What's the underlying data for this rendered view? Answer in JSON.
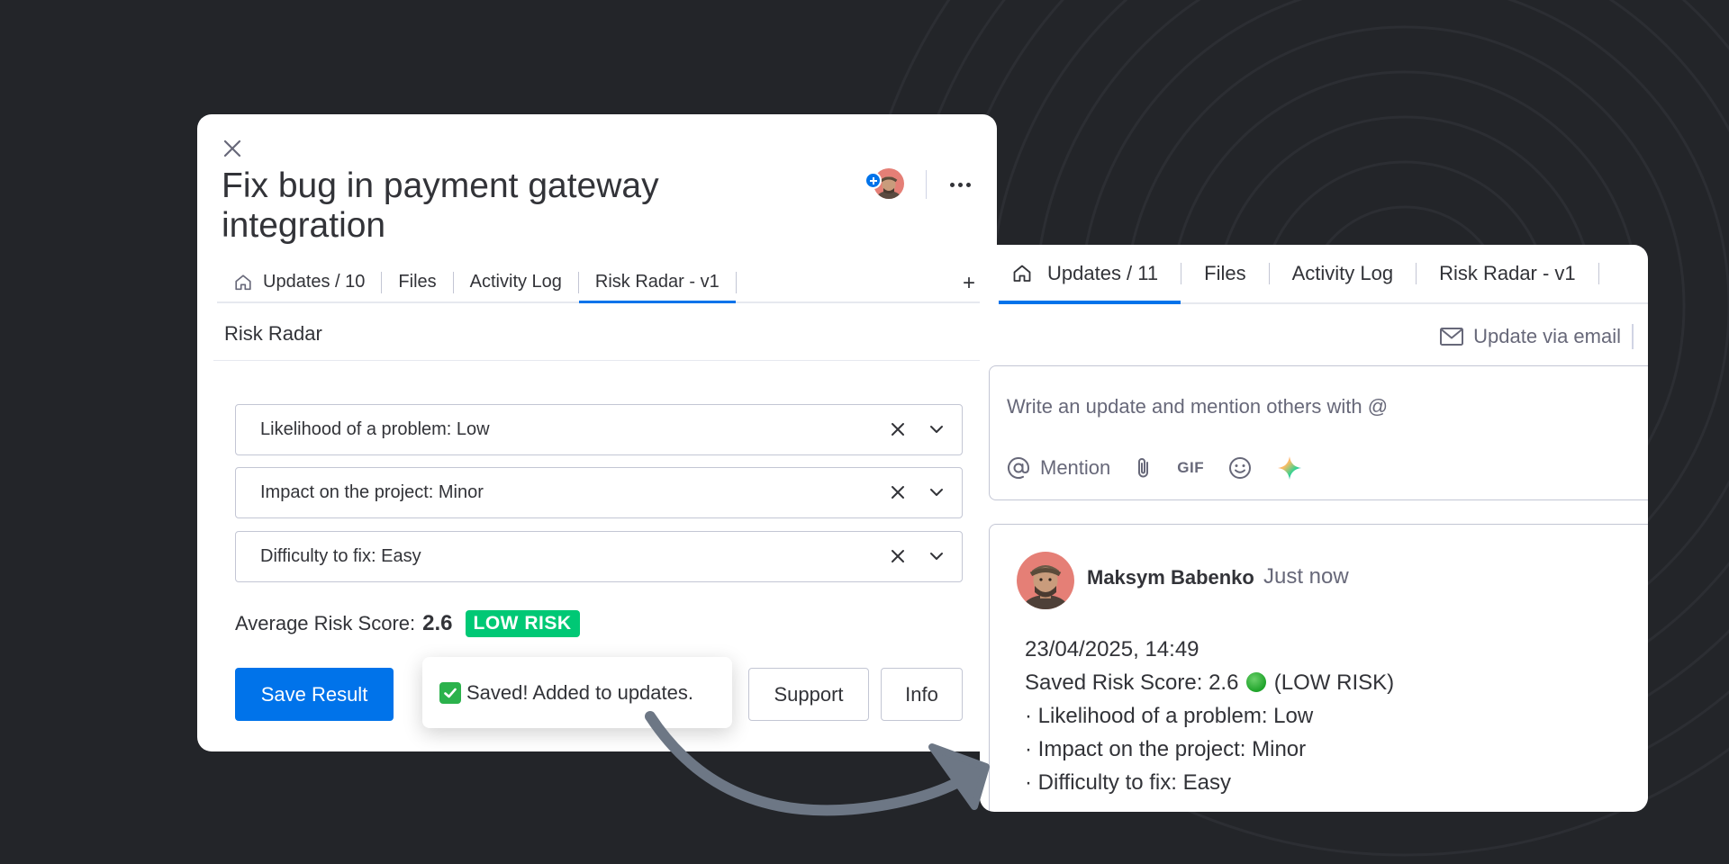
{
  "item": {
    "title": "Fix bug in payment gateway integration"
  },
  "left_tabs": [
    {
      "label": "Updates / 10",
      "icon": "home-icon"
    },
    {
      "label": "Files"
    },
    {
      "label": "Activity Log"
    },
    {
      "label": "Risk Radar - v1",
      "active": true
    }
  ],
  "left_tab_add": "+",
  "risk": {
    "section_title": "Risk Radar",
    "dropdowns": [
      "Likelihood of a problem: Low",
      "Impact on the project: Minor",
      "Difficulty to fix: Easy"
    ],
    "avg_label": "Average Risk Score:",
    "avg_value": "2.6",
    "badge": "LOW RISK",
    "badge_color": "#00c875",
    "save_label": "Save Result",
    "support_label": "Support",
    "info_label": "Info"
  },
  "toast": {
    "text": "Saved! Added to updates.",
    "icon": "check-mark-icon"
  },
  "right_tabs": [
    {
      "label": "Updates / 11",
      "icon": "home-icon",
      "active": true
    },
    {
      "label": "Files"
    },
    {
      "label": "Activity Log"
    },
    {
      "label": "Risk Radar - v1"
    }
  ],
  "update_via_email": "Update via email",
  "composer": {
    "placeholder": "Write an update and mention others with @",
    "mention_label": "Mention",
    "gif_label": "GIF"
  },
  "post": {
    "author": "Maksym Babenko",
    "time": "Just now",
    "lines": {
      "date": "23/04/2025, 14:49",
      "score_prefix": "Saved Risk Score: 2.6",
      "score_suffix": "(LOW RISK)",
      "l1": "· Likelihood of a problem: Low",
      "l2": "· Impact on the project: Minor",
      "l3": "· Difficulty to fix: Easy"
    }
  },
  "colors": {
    "accent": "#0073ea",
    "background": "#232529"
  }
}
